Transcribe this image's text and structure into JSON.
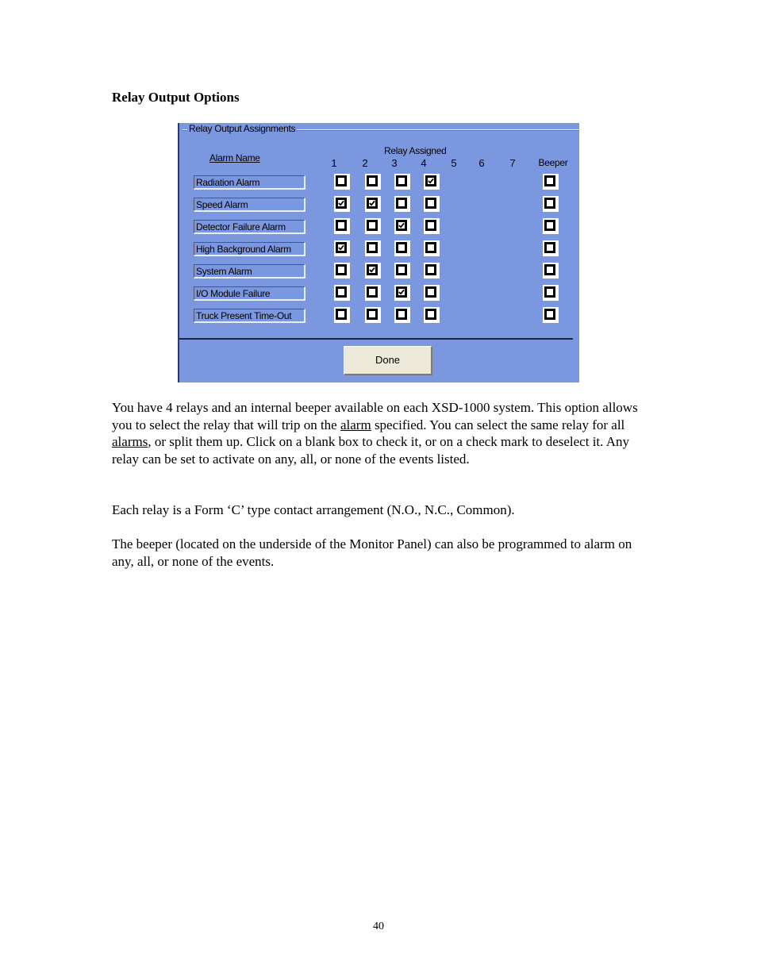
{
  "document": {
    "heading": "Relay Output Options",
    "page_number": "40"
  },
  "dialog": {
    "group_title": "Relay Output Assignments",
    "alarm_name_header": "Alarm Name",
    "relay_assigned_header": "Relay Assigned",
    "columns": [
      "1",
      "2",
      "3",
      "4",
      "5",
      "6",
      "7",
      "Beeper"
    ],
    "rows": [
      {
        "name": "Radiation Alarm",
        "relays": [
          false,
          false,
          false,
          true
        ],
        "beeper": false
      },
      {
        "name": "Speed Alarm",
        "relays": [
          true,
          true,
          false,
          false
        ],
        "beeper": false
      },
      {
        "name": "Detector Failure Alarm",
        "relays": [
          false,
          false,
          true,
          false
        ],
        "beeper": false
      },
      {
        "name": "High Background Alarm",
        "relays": [
          true,
          false,
          false,
          false
        ],
        "beeper": false
      },
      {
        "name": "System Alarm",
        "relays": [
          false,
          true,
          false,
          false
        ],
        "beeper": false
      },
      {
        "name": " I/O Module Failure",
        "relays": [
          false,
          false,
          true,
          false
        ],
        "beeper": false
      },
      {
        "name": "Truck Present Time-Out",
        "relays": [
          false,
          false,
          false,
          false
        ],
        "beeper": false
      }
    ],
    "done_label": "Done",
    "colors": {
      "panel_bg": "#7b97e0",
      "button_bg": "#ece9d8"
    }
  },
  "body": {
    "p1": {
      "part1": "You have 4 relays and an internal beeper available on each XSD-1000 system.  This option allows you to select the relay that will trip on the ",
      "link1": "alarm",
      "part2": " specified.  You can select the same relay for all ",
      "link2": "alarms",
      "part3": ", or split them up.  Click on a blank box to check it, or on a check mark to deselect it.  Any relay can be set to activate on any, all, or none of the events listed."
    },
    "p2": "Each relay is a Form ‘C’ type contact arrangement (N.O., N.C., Common).",
    "p3": "The beeper (located on the underside of the Monitor Panel) can also be programmed to alarm on any, all, or none of the events."
  }
}
